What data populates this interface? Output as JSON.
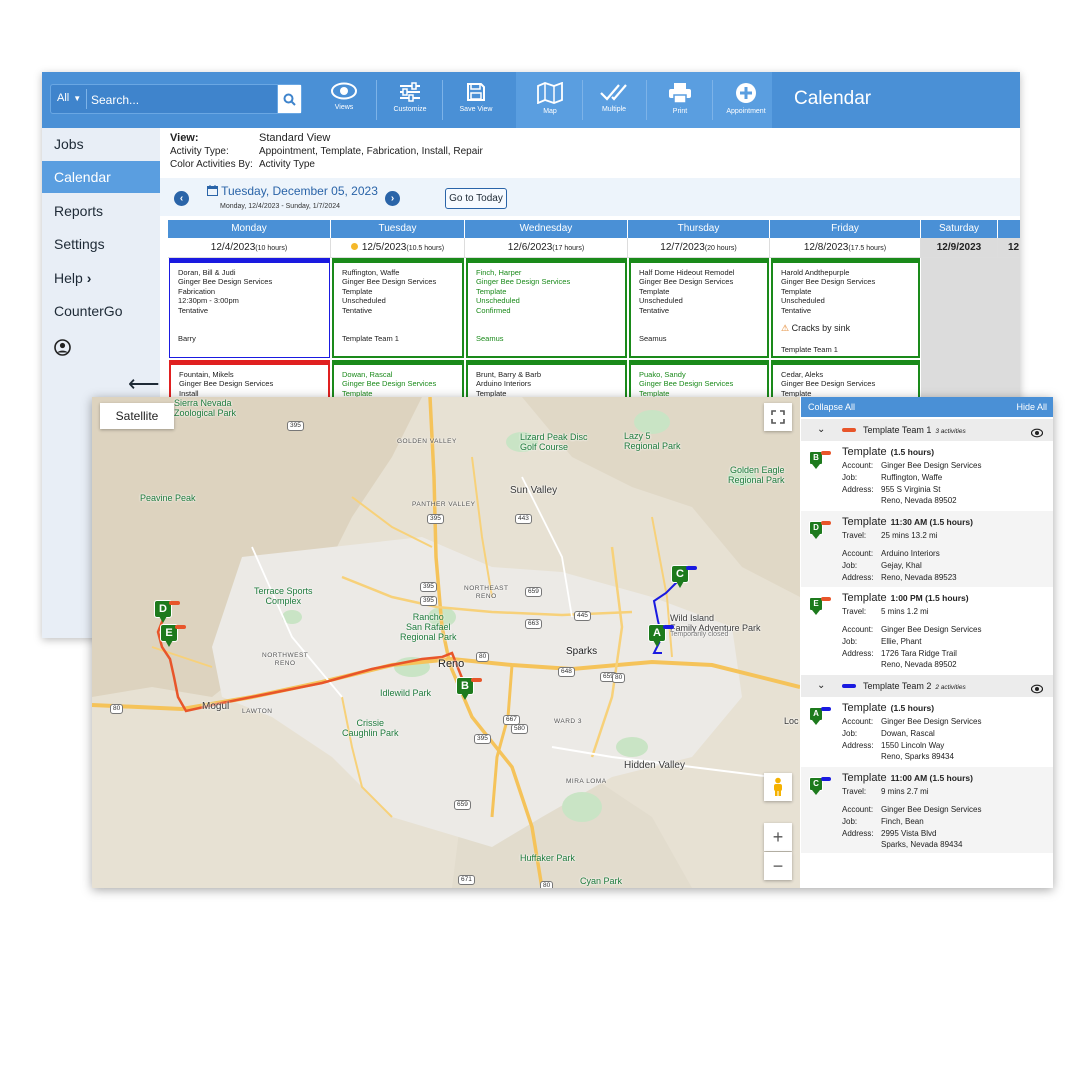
{
  "toolbar": {
    "search_scope": "All",
    "search_placeholder": "Search...",
    "buttons": [
      "Views",
      "Customize",
      "Save View",
      "Map",
      "Multiple",
      "Print",
      "Appointment"
    ],
    "title": "Calendar"
  },
  "sidebar": {
    "items": [
      "Jobs",
      "Calendar",
      "Reports",
      "Settings",
      "Help",
      "CounterGo"
    ],
    "help_chevron": "›",
    "back_arrow": "⟵"
  },
  "view_info": {
    "view_label": "View:",
    "view_value": "Standard View",
    "activity_type_label": "Activity Type:",
    "activity_type_value": "Appointment, Template, Fabrication, Install, Repair",
    "color_by_label": "Color Activities By:",
    "color_by_value": "Activity Type"
  },
  "date_nav": {
    "current_date": "Tuesday, December 05, 2023",
    "range": "Monday, 12/4/2023 - Sunday, 1/7/2024",
    "go_to_today": "Go to Today"
  },
  "calendar": {
    "days": [
      {
        "name": "Monday",
        "date": "12/4/2023",
        "hours": "(10 hours)"
      },
      {
        "name": "Tuesday",
        "date": "12/5/2023",
        "hours": "(10.5 hours)"
      },
      {
        "name": "Wednesday",
        "date": "12/6/2023",
        "hours": "(17 hours)"
      },
      {
        "name": "Thursday",
        "date": "12/7/2023",
        "hours": "(20 hours)"
      },
      {
        "name": "Friday",
        "date": "12/8/2023",
        "hours": "(17.5 hours)"
      },
      {
        "name": "Saturday",
        "date": "12/9/2023",
        "hours": ""
      },
      {
        "name": "",
        "date": "12",
        "hours": ""
      }
    ],
    "events_row1": [
      {
        "lines": [
          "Doran, Bill & Judi",
          "Ginger Bee Design Services",
          "Fabrication",
          "12:30pm - 3:00pm",
          "Tentative"
        ],
        "footer": "Barry",
        "color": "#1a1ae0",
        "style": "normal"
      },
      {
        "lines": [
          "Ruffington, Waffe",
          "Ginger Bee Design Services",
          "Template",
          "Unscheduled",
          "Tentative"
        ],
        "footer": "Template Team 1",
        "color": "#1a8a1a",
        "style": "normal"
      },
      {
        "lines": [
          "Finch, Harper",
          "Ginger Bee Design Services",
          "Template",
          "Unscheduled",
          "Confirmed"
        ],
        "footer": "Seamus",
        "color": "#1a8a1a",
        "style": "green"
      },
      {
        "lines": [
          "Half Dome Hideout Remodel",
          "Ginger Bee Design Services",
          "Template",
          "Unscheduled",
          "Tentative"
        ],
        "footer": "Seamus",
        "color": "#1a8a1a",
        "style": "normal"
      },
      {
        "lines": [
          "Harold Andthepurple",
          "Ginger Bee Design Services",
          "Template",
          "Unscheduled",
          "Tentative"
        ],
        "note": "Cracks by sink",
        "footer": "Template Team 1",
        "color": "#1a8a1a",
        "style": "normal"
      }
    ],
    "events_row2": [
      {
        "lines": [
          "Fountain, Mikels",
          "Ginger Bee Design Services",
          "Install"
        ],
        "color": "#e02020",
        "style": "normal"
      },
      {
        "lines": [
          "Dowan, Rascal",
          "Ginger Bee Design Services",
          "Template"
        ],
        "color": "#1a8a1a",
        "style": "green"
      },
      {
        "lines": [
          "Brunt, Barry & Barb",
          "Arduino Interiors",
          "Template"
        ],
        "color": "#1a8a1a",
        "style": "normal"
      },
      {
        "lines": [
          "Puako, Sandy",
          "Ginger Bee Design Services",
          "Template"
        ],
        "color": "#1a8a1a",
        "style": "green"
      },
      {
        "lines": [
          "Cedar, Aleks",
          "Ginger Bee Design Services",
          "Template"
        ],
        "color": "#1a8a1a",
        "style": "normal"
      }
    ]
  },
  "map": {
    "satellite_label": "Satellite",
    "zoom_in": "+",
    "zoom_out": "−",
    "labels": {
      "sierra_nevada_zoo": "Sierra Nevada\nZoological Park",
      "golden_valley": "GOLDEN VALLEY",
      "lizard_peak": "Lizard Peak Disc\nGolf Course",
      "lazy5": "Lazy 5\nRegional Park",
      "golden_eagle": "Golden Eagle\nRegional Park",
      "peavine_peak": "Peavine Peak",
      "sun_valley": "Sun Valley",
      "panther_valley": "PANTHER VALLEY",
      "terrace_sports": "Terrace Sports\nComplex",
      "northeast_reno": "NORTHEAST\nRENO",
      "wild_island": "Wild Island\nFamily Adventure Park",
      "temp_closed": "Temporarily closed",
      "rancho": "Rancho\nSan Rafael\nRegional Park",
      "northwest_reno": "NORTHWEST\nRENO",
      "reno": "Reno",
      "sparks": "Sparks",
      "idlewild": "Idlewild Park",
      "mogul": "Mogul",
      "lawton": "LAWTON",
      "crissie": "Crissie\nCaughlin Park",
      "ward3": "WARD 3",
      "hidden_valley": "Hidden Valley",
      "loc": "Loc",
      "mira_loma": "MIRA LOMA",
      "huffaker": "Huffaker Park",
      "cyan": "Cyan Park"
    },
    "highway_shields": [
      "395",
      "395",
      "443",
      "395",
      "659",
      "445",
      "395",
      "663",
      "80",
      "648",
      "659",
      "80",
      "80",
      "667",
      "395",
      "580",
      "659",
      "671",
      "80"
    ],
    "markers": [
      "A",
      "B",
      "C",
      "D",
      "E"
    ]
  },
  "panel": {
    "collapse_all": "Collapse All",
    "hide_all": "Hide All",
    "teams": [
      {
        "name": "Template Team 1",
        "count": "3 activities",
        "color": "#e8552a"
      },
      {
        "name": "Template Team 2",
        "count": "2 activities",
        "color": "#1a1ae0"
      }
    ],
    "activities": [
      {
        "marker": "B",
        "title": "Template",
        "time": "(1.5 hours)",
        "account": "Ginger Bee Design Services",
        "job": "Ruffington, Waffe",
        "address1": "955 S Virginia St",
        "address2": "Reno, Nevada 89502"
      },
      {
        "marker": "D",
        "title": "Template",
        "time": "11:30 AM (1.5 hours)",
        "travel": "25 mins  13.2 mi",
        "account": "Arduino Interiors",
        "job": "Gejay, Khal",
        "address1": "Reno, Nevada 89523",
        "address2": ""
      },
      {
        "marker": "E",
        "title": "Template",
        "time": "1:00 PM (1.5 hours)",
        "travel": "5 mins  1.2 mi",
        "account": "Ginger Bee Design Services",
        "job": "Ellie, Phant",
        "address1": "1726 Tara Ridge Trail",
        "address2": "Reno, Nevada 89502"
      },
      {
        "marker": "A",
        "title": "Template",
        "time": "(1.5 hours)",
        "account": "Ginger Bee Design Services",
        "job": "Dowan, Rascal",
        "address1": "1550 Lincoln Way",
        "address2": "Reno, Sparks 89434"
      },
      {
        "marker": "C",
        "title": "Template",
        "time": "11:00 AM (1.5 hours)",
        "travel": "9 mins  2.7 mi",
        "account": "Ginger Bee Design Services",
        "job": "Finch, Bean",
        "address1": "2995 Vista Blvd",
        "address2": "Sparks, Nevada 89434"
      }
    ],
    "labels": {
      "account": "Account:",
      "job": "Job:",
      "address": "Address:",
      "travel": "Travel:"
    }
  },
  "colors": {
    "accent": "#4a90d6",
    "team1": "#e8552a",
    "team2": "#1a1ae0",
    "marker": "#1d7a1d"
  }
}
